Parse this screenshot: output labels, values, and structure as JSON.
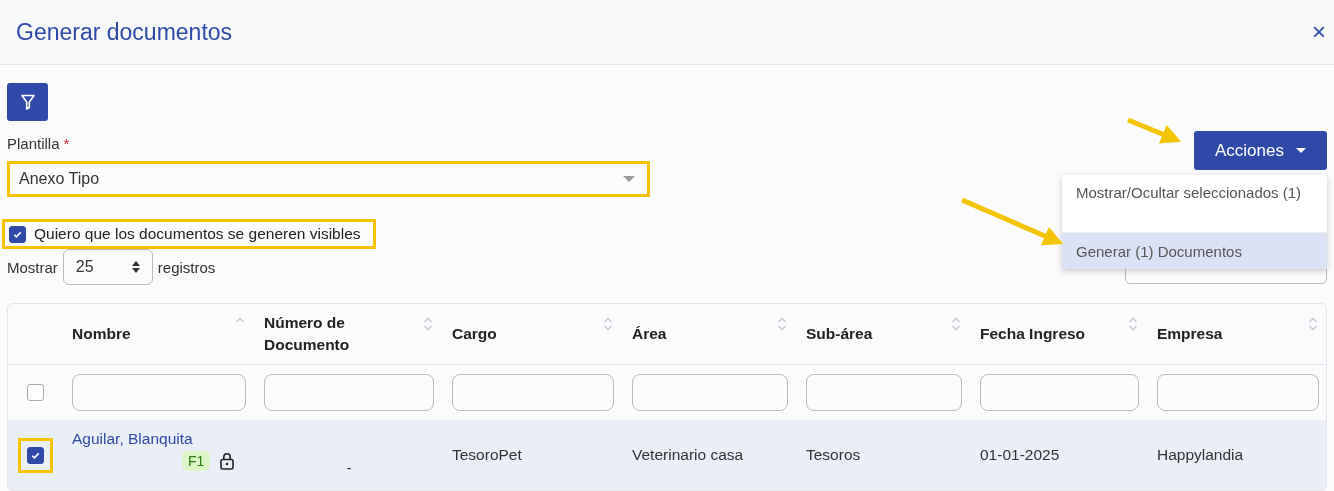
{
  "dialog": {
    "title": "Generar documentos",
    "close": "×"
  },
  "template": {
    "label": "Plantilla",
    "required_mark": "*",
    "value": "Anexo Tipo",
    "highlighted": true
  },
  "visible_option": {
    "label": "Quiero que los documentos se generen visibles",
    "checked": true,
    "highlighted": true
  },
  "page_size": {
    "prefix": "Mostrar",
    "value": "25",
    "suffix": "registros"
  },
  "actions": {
    "label": "Acciones",
    "expanded": true,
    "items": [
      {
        "label": "Mostrar/Ocultar seleccionados (1)",
        "selected": false
      },
      {
        "label": "Generar (1) Documentos",
        "selected": true
      }
    ]
  },
  "table": {
    "select_all": {
      "checked": false
    },
    "columns": [
      {
        "label": "Nombre",
        "sorted_ascending": true
      },
      {
        "label": "Número de Documento",
        "sorted_ascending": false
      },
      {
        "label": "Cargo",
        "sorted_ascending": false
      },
      {
        "label": "Área",
        "sorted_ascending": false
      },
      {
        "label": "Sub-área",
        "sorted_ascending": false
      },
      {
        "label": "Fecha Ingreso",
        "sorted_ascending": false
      },
      {
        "label": "Empresa",
        "sorted_ascending": false
      }
    ],
    "rows": [
      {
        "selected": true,
        "highlighted": true,
        "tag": "F1",
        "locked": true,
        "cells": [
          "Aguilar, Blanquita",
          "-",
          "TesoroPet",
          "Veterinario casa",
          "Tesoros",
          "01-01-2025",
          "Happylandia"
        ]
      }
    ]
  }
}
